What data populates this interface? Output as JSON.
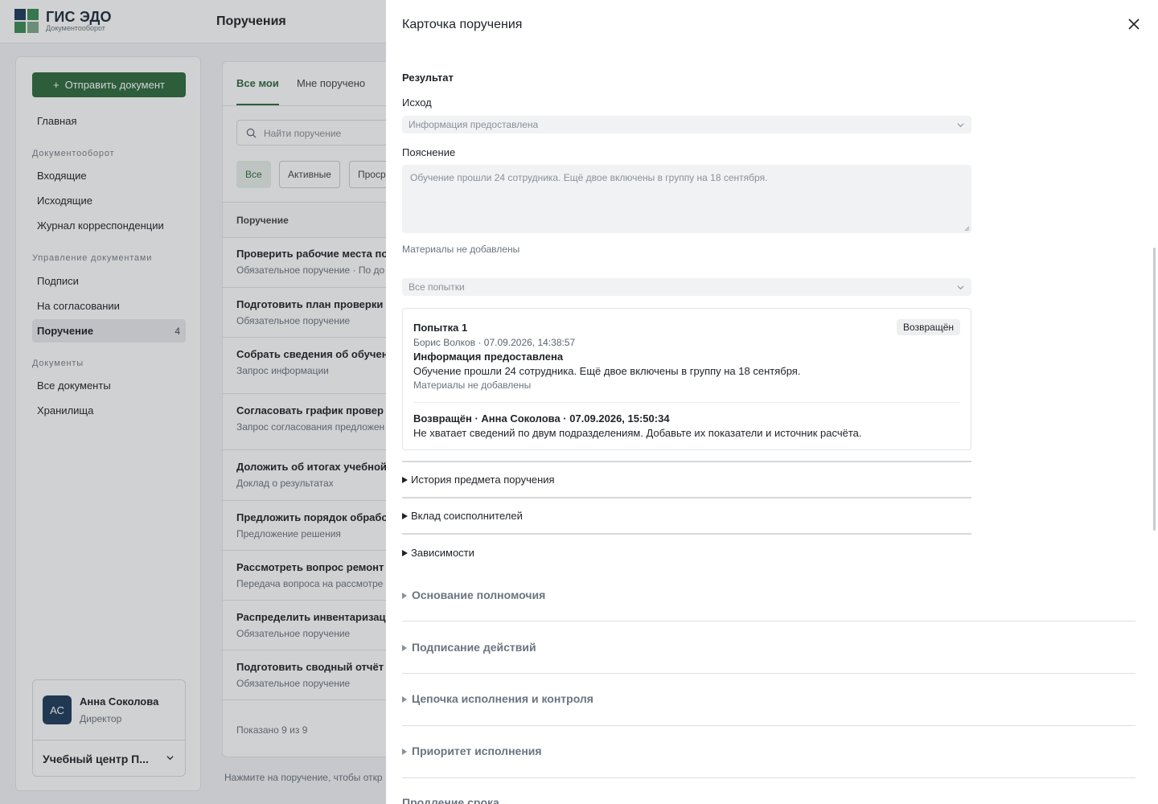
{
  "brand": {
    "title": "ГИС ЭДО",
    "subtitle": "Документооборот"
  },
  "page_title": "Поручения",
  "sidebar": {
    "send_button": "Отправить документ",
    "home": "Главная",
    "sections": [
      {
        "title": "Документооборот",
        "items": [
          "Входящие",
          "Исходящие",
          "Журнал корреспонденции"
        ]
      },
      {
        "title": "Управление документами",
        "items": [
          "Подписи",
          "На согласовании",
          "Поручение"
        ]
      },
      {
        "title": "Документы",
        "items": [
          "Все документы",
          "Хранилища"
        ]
      }
    ],
    "active_count": "4",
    "user": {
      "initials": "АС",
      "name": "Анна Соколова",
      "role": "Директор",
      "org": "Учебный центр П..."
    }
  },
  "main": {
    "tabs": [
      "Все мои",
      "Мне поручено"
    ],
    "search_placeholder": "Найти поручение",
    "filters": [
      "Все",
      "Активные",
      "Проср"
    ],
    "column_header": "Поручение",
    "rows": [
      {
        "title": "Проверить рабочие места по",
        "sub": "Обязательное поручение · По до"
      },
      {
        "title": "Подготовить план проверки",
        "sub": "Обязательное поручение"
      },
      {
        "title": "Собрать сведения об обучен",
        "sub": "Запрос информации"
      },
      {
        "title": "Согласовать график провер",
        "sub": "Запрос согласования предложен"
      },
      {
        "title": "Доложить об итогах учебной",
        "sub": "Доклад о результатах"
      },
      {
        "title": "Предложить порядок обрабо",
        "sub": "Предложение решения"
      },
      {
        "title": "Рассмотреть вопрос ремонт",
        "sub": "Передача вопроса на рассмотре"
      },
      {
        "title": "Распределить инвентаризац",
        "sub": "Обязательное поручение"
      },
      {
        "title": "Подготовить сводный отчёт",
        "sub": "Обязательное поручение"
      }
    ],
    "shown": "Показано 9 из 9",
    "hint": "Нажмите на поручение, чтобы откр"
  },
  "drawer": {
    "title": "Карточка поручения",
    "result_heading": "Результат",
    "outcome_label": "Исход",
    "outcome_value": "Информация предоставлена",
    "explanation_label": "Пояснение",
    "explanation_value": "Обучение прошли 24 сотрудника. Ещё двое включены в группу на 18 сентября.",
    "materials_note": "Материалы не добавлены",
    "attempts_filter": "Все попытки",
    "attempt": {
      "title": "Попытка 1",
      "badge": "Возвращён",
      "meta": "Борис Волков · 07.09.2026, 14:38:57",
      "outcome": "Информация предоставлена",
      "text": "Обучение прошли 24 сотрудника. Ещё двое включены в группу на 18 сентября.",
      "materials": "Материалы не добавлены",
      "return_line": "Возвращён · Анна Соколова · 07.09.2026, 15:50:34",
      "return_comment": "Не хватает сведений по двум подразделениям. Добавьте их показатели и источник расчёта."
    },
    "details": [
      "История предмета поручения",
      "Вклад соисполнителей",
      "Зависимости"
    ],
    "blocks": [
      "Основание полномочия",
      "Подписание действий",
      "Цепочка исполнения и контроля",
      "Приоритет исполнения"
    ],
    "last_block": "Продление срока"
  },
  "colors": {
    "accent": "#2f6b3e",
    "brand_dark": "#1f3b5c"
  }
}
